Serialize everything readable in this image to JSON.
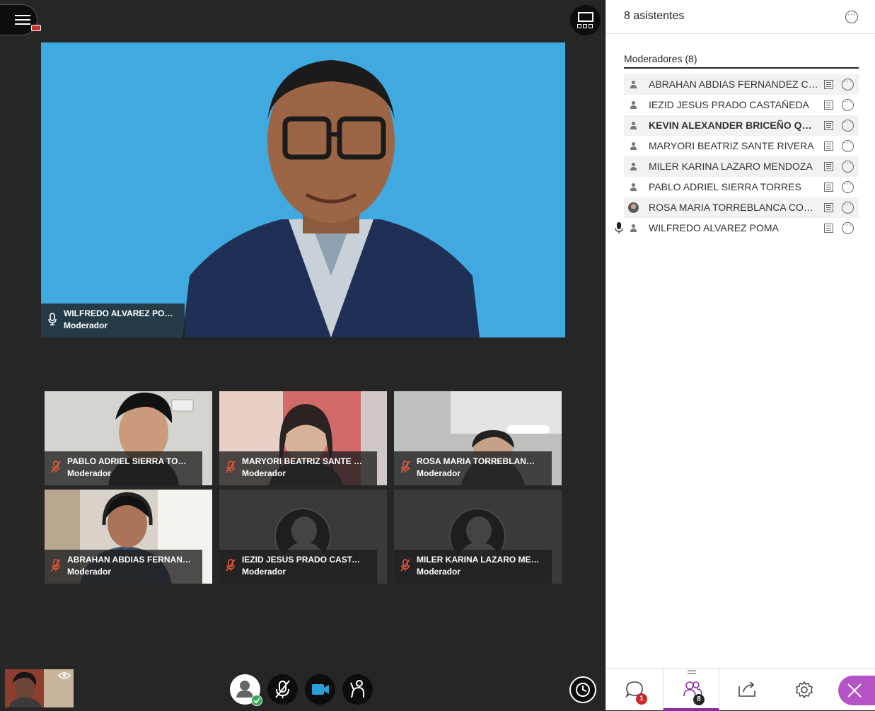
{
  "panel": {
    "title": "8 asistentes",
    "section_title": "Moderadores (8)",
    "attendees": [
      {
        "name": "ABRAHAN ABDIAS FERNANDEZ CHI...",
        "bold": false,
        "photo": false,
        "mic": false
      },
      {
        "name": "IEZID JESUS PRADO CASTAÑEDA",
        "bold": false,
        "photo": false,
        "mic": false
      },
      {
        "name": "KEVIN ALEXANDER BRICEÑO QUE...",
        "bold": true,
        "photo": false,
        "mic": false
      },
      {
        "name": "MARYORI BEATRIZ SANTE RIVERA",
        "bold": false,
        "photo": false,
        "mic": false
      },
      {
        "name": "MILER KARINA LAZARO MENDOZA",
        "bold": false,
        "photo": false,
        "mic": false
      },
      {
        "name": "PABLO ADRIEL SIERRA TORRES",
        "bold": false,
        "photo": false,
        "mic": false
      },
      {
        "name": "ROSA MARIA TORREBLANCA CONT...",
        "bold": false,
        "photo": true,
        "mic": false
      },
      {
        "name": "WILFREDO ALVAREZ POMA",
        "bold": false,
        "photo": false,
        "mic": true
      }
    ],
    "tabs": {
      "chat_badge": "1",
      "attendees_badge": "8"
    }
  },
  "main_video": {
    "name": "WILFREDO ALVAREZ POMA",
    "role": "Moderador"
  },
  "tiles": [
    {
      "name": "PABLO ADRIEL SIERRA TORRES",
      "role": "Moderador"
    },
    {
      "name": "MARYORI BEATRIZ SANTE RIVE...",
      "role": "Moderador"
    },
    {
      "name": "ROSA MARIA TORREBLANCA C...",
      "role": "Moderador"
    },
    {
      "name": "ABRAHAN ABDIAS FERNANDEZ...",
      "role": "Moderador"
    },
    {
      "name": "IEZID JESUS PRADO CASTAÑEDA",
      "role": "Moderador"
    },
    {
      "name": "MILER KARINA LAZARO MEND...",
      "role": "Moderador"
    }
  ],
  "colors": {
    "accent": "#8a2ca0",
    "close_button": "#b452c6",
    "muted_mic": "#e8573a",
    "camera_on": "#2a9fd8",
    "status_ok": "#2eaa4f",
    "badge": "#c62828"
  }
}
